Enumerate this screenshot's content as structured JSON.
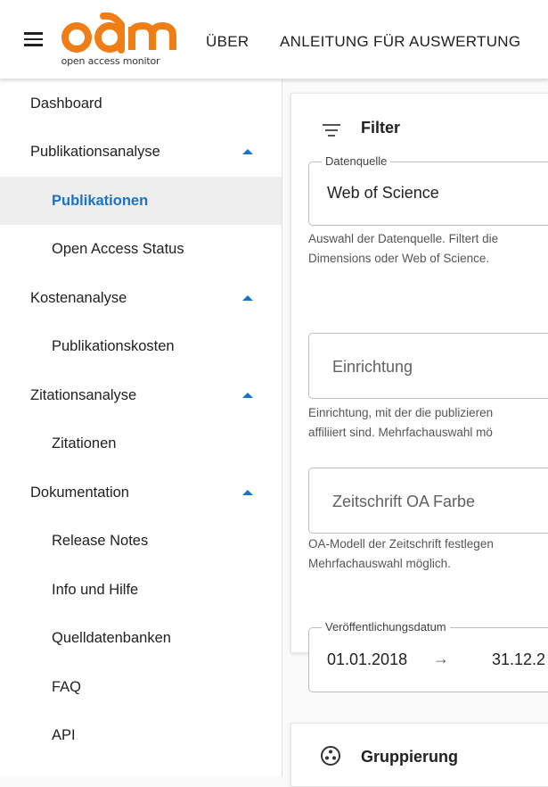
{
  "header": {
    "logo_text": "oam",
    "logo_subtitle": "open access monitor",
    "nav": [
      "ÜBER",
      "ANLEITUNG FÜR AUSWERTUNG"
    ]
  },
  "sidebar": {
    "items": [
      {
        "label": "Dashboard",
        "kind": "top"
      },
      {
        "label": "Publikationsanalyse",
        "kind": "group",
        "expanded": true
      },
      {
        "label": "Publikationen",
        "kind": "sub",
        "active": true
      },
      {
        "label": "Open Access Status",
        "kind": "sub"
      },
      {
        "label": "Kostenanalyse",
        "kind": "group",
        "expanded": true
      },
      {
        "label": "Publikationskosten",
        "kind": "sub"
      },
      {
        "label": "Zitationsanalyse",
        "kind": "group",
        "expanded": true
      },
      {
        "label": "Zitationen",
        "kind": "sub"
      },
      {
        "label": "Dokumentation",
        "kind": "group",
        "expanded": true
      },
      {
        "label": "Release Notes",
        "kind": "sub"
      },
      {
        "label": "Info und Hilfe",
        "kind": "sub"
      },
      {
        "label": "Quelldatenbanken",
        "kind": "sub"
      },
      {
        "label": "FAQ",
        "kind": "sub"
      },
      {
        "label": "API",
        "kind": "sub"
      }
    ]
  },
  "filter": {
    "title": "Filter",
    "datenquelle": {
      "label": "Datenquelle",
      "value": "Web of Science",
      "help1": "Auswahl der Datenquelle. Filtert die",
      "help2": "Dimensions oder Web of Science."
    },
    "einrichtung": {
      "placeholder": "Einrichtung",
      "help1": "Einrichtung, mit der die publizieren",
      "help2": "affiliiert sind. Mehrfachauswahl mö"
    },
    "zeitschrift": {
      "placeholder": "Zeitschrift OA Farbe",
      "help1": "OA-Modell der Zeitschrift festlegen",
      "help2": "Mehrfachauswahl möglich."
    },
    "datum": {
      "label": "Veröffentlichungsdatum",
      "from": "01.01.2018",
      "arrow": "→",
      "to": "31.12.2"
    }
  },
  "gruppierung": {
    "title": "Gruppierung"
  },
  "colors": {
    "accent": "#1a73c7",
    "logo": "#f07d16"
  }
}
